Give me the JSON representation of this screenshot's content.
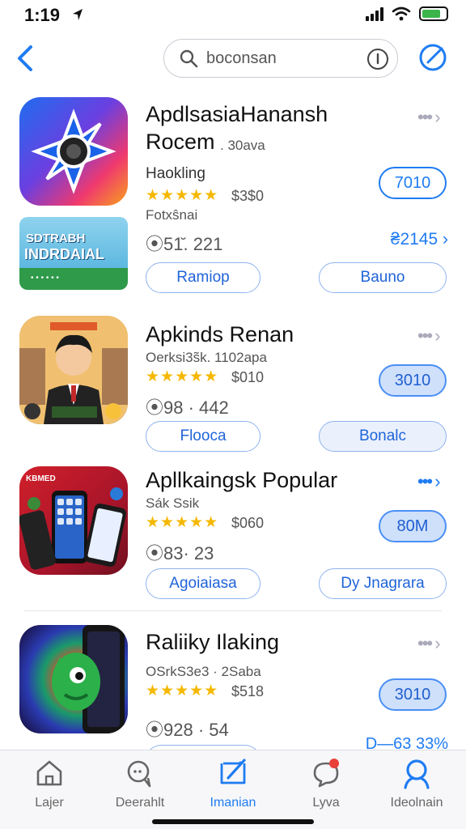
{
  "status": {
    "time": "1:19"
  },
  "nav": {
    "search_value": "boconsan"
  },
  "apps": [
    {
      "title": "ApdlsasiaHanansh",
      "title2": "Rocem",
      "subtitle": ". 30ava",
      "category": "Haokling",
      "price": "$3$0",
      "developer": "Fotxŝnai",
      "stats": "⦿51̆. 221",
      "action_pill": "7010",
      "side_link": "₴2145 ›",
      "btn_left": "Ramiop",
      "btn_right": "Bauno",
      "promo_line1": "SDTRABH",
      "promo_line2": "INDRDAIAL",
      "promo_line3": "• • • • • •"
    },
    {
      "title": "Apkinds Renan",
      "subtitle": "Oerksi3s̃k. 1102apa",
      "price": "$010",
      "stats": "⦿98 · 442",
      "action_pill": "3010",
      "btn_left": "Flooca",
      "btn_right": "Bonalc"
    },
    {
      "title": "Apllkaingsk Popular",
      "subtitle": "Sák Ssik",
      "price": "$060",
      "stats": "⦿83· 23",
      "action_pill": "80M",
      "btn_left": "Agoiaiasa",
      "btn_right": "Dy Jnagrara",
      "icon_label": "KBMED"
    },
    {
      "title": "Raliiky Ilaking",
      "subtitle": "OSrkS3e3 · 2Saba",
      "price": "$518",
      "stats": "⦿928 · 54",
      "action_pill": "3010",
      "side_link": "D—63 33%"
    }
  ],
  "rating_stars": "★★★★★",
  "more_glyph": "••• ›",
  "tabs": [
    {
      "label": "Lajer",
      "icon": "home-icon"
    },
    {
      "label": "Deerahlt",
      "icon": "chat-search-icon"
    },
    {
      "label": "Imanian",
      "icon": "compose-icon",
      "active": true
    },
    {
      "label": "Lyva",
      "icon": "notification-chat-icon"
    },
    {
      "label": "Ideolnain",
      "icon": "profile-search-icon"
    }
  ],
  "colors": {
    "accent": "#1f7cf2",
    "star": "#f5b800"
  }
}
